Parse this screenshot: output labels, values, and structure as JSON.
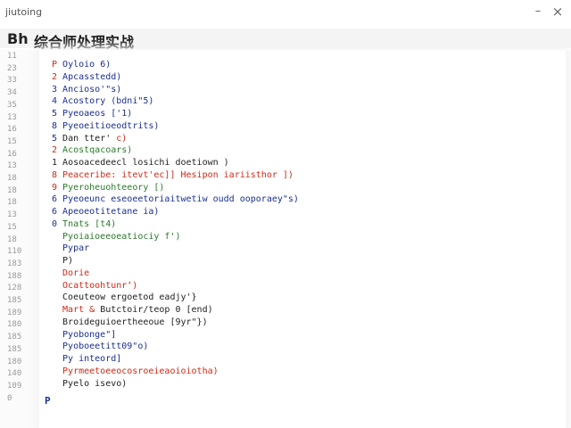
{
  "window": {
    "app_title": "jiutoing",
    "minimize_glyph": "–",
    "close_glyph": "×"
  },
  "document": {
    "prefix": "Bh",
    "title": "综合师处理实战"
  },
  "gutter": {
    "line_numbers": [
      "11",
      "23",
      "33",
      "34",
      "35",
      "13",
      "16",
      "15",
      "16",
      "13",
      "18",
      "18",
      "18",
      "13",
      "15",
      "18",
      "110",
      "183",
      "188",
      "128",
      "185",
      "189",
      "180",
      "185",
      "185",
      "180",
      "140",
      "109",
      "0"
    ]
  },
  "code_lines": [
    {
      "segments": [
        {
          "text": "P ",
          "color": "red"
        },
        {
          "text": "Oyloio 6)",
          "color": "blue"
        }
      ]
    },
    {
      "segments": [
        {
          "text": "2 ",
          "color": "red"
        },
        {
          "text": "Apcasstedd)",
          "color": "blue"
        }
      ]
    },
    {
      "segments": [
        {
          "text": "3 ",
          "color": "blue"
        },
        {
          "text": "Ancioso'\"s)",
          "color": "blue"
        }
      ]
    },
    {
      "segments": [
        {
          "text": "4 ",
          "color": "blue"
        },
        {
          "text": "Acostory (bdni\"5)",
          "color": "blue"
        }
      ]
    },
    {
      "segments": [
        {
          "text": "5 ",
          "color": "blue"
        },
        {
          "text": "Pyeoaeos ['1)",
          "color": "blue"
        }
      ]
    },
    {
      "segments": [
        {
          "text": "8 ",
          "color": "blue"
        },
        {
          "text": "Pyeoeitioeodtrits)",
          "color": "blue"
        }
      ]
    },
    {
      "segments": [
        {
          "text": "5 ",
          "color": "blue"
        },
        {
          "text": "Dan tter' ",
          "color": "dark"
        },
        {
          "text": "c)",
          "color": "red"
        }
      ]
    },
    {
      "segments": [
        {
          "text": "2 ",
          "color": "red"
        },
        {
          "text": "Acostqacoars)",
          "color": "green"
        }
      ]
    },
    {
      "segments": [
        {
          "text": "1 ",
          "color": "dark"
        },
        {
          "text": "Aosoacedeecl losichi doetiown )",
          "color": "dark"
        }
      ]
    },
    {
      "segments": [
        {
          "text": "8 ",
          "color": "red"
        },
        {
          "text": "Peaceribe: itevt'ec]] ",
          "color": "red"
        },
        {
          "text": "Hesipon iariisthor ])",
          "color": "red"
        }
      ]
    },
    {
      "segments": [
        {
          "text": "9 ",
          "color": "red"
        },
        {
          "text": "Pyeroheuohteeory [)",
          "color": "green"
        }
      ]
    },
    {
      "segments": [
        {
          "text": "6 ",
          "color": "blue"
        },
        {
          "text": "Pyeoeunc eseoeetoriaitwetiw oudd ooporaey\"s)",
          "color": "blue"
        }
      ]
    },
    {
      "segments": [
        {
          "text": "6 ",
          "color": "blue"
        },
        {
          "text": "Apeoeotitetane ia)",
          "color": "blue"
        }
      ]
    },
    {
      "segments": [
        {
          "text": "0 ",
          "color": "blue"
        },
        {
          "text": "Tnats [t4)",
          "color": "green"
        }
      ]
    },
    {
      "segments": [
        {
          "text": "  Pyoiaioeeoeatiociy f')",
          "color": "green"
        }
      ]
    },
    {
      "segments": [
        {
          "text": "  Pypar",
          "color": "blue"
        }
      ]
    },
    {
      "segments": [
        {
          "text": "  P)",
          "color": "dark"
        }
      ]
    },
    {
      "segments": [
        {
          "text": "  Dorie",
          "color": "red"
        }
      ]
    },
    {
      "segments": [
        {
          "text": "  Ocattoohtunr‘)",
          "color": "red"
        }
      ]
    },
    {
      "segments": [
        {
          "text": "  Coeuteow ergoetod eadjy'}",
          "color": "dark"
        }
      ]
    },
    {
      "segments": [
        {
          "text": "  Mart & ",
          "color": "red"
        },
        {
          "text": "Butctoir/teop 0 [end)",
          "color": "dark"
        }
      ]
    },
    {
      "segments": [
        {
          "text": "  Broideguioertheeoue [9yr\"})",
          "color": "dark"
        }
      ]
    },
    {
      "segments": [
        {
          "text": "  Pyobonge\"]",
          "color": "blue"
        }
      ]
    },
    {
      "segments": [
        {
          "text": "  Pyoboeetitt09\"o)",
          "color": "blue"
        }
      ]
    },
    {
      "segments": [
        {
          "text": "  Py inteord]",
          "color": "blue"
        }
      ]
    },
    {
      "segments": [
        {
          "text": "  Pyrmeetoeeocosroeieaoioiotha)",
          "color": "red"
        }
      ]
    },
    {
      "segments": [
        {
          "text": "  Pyelo isevo)",
          "color": "dark"
        }
      ]
    }
  ],
  "cursor_glyph": "P",
  "colors": {
    "red": "#cc2b18",
    "blue": "#1b2f8f",
    "green": "#2a7a2a",
    "dark": "#222222"
  }
}
